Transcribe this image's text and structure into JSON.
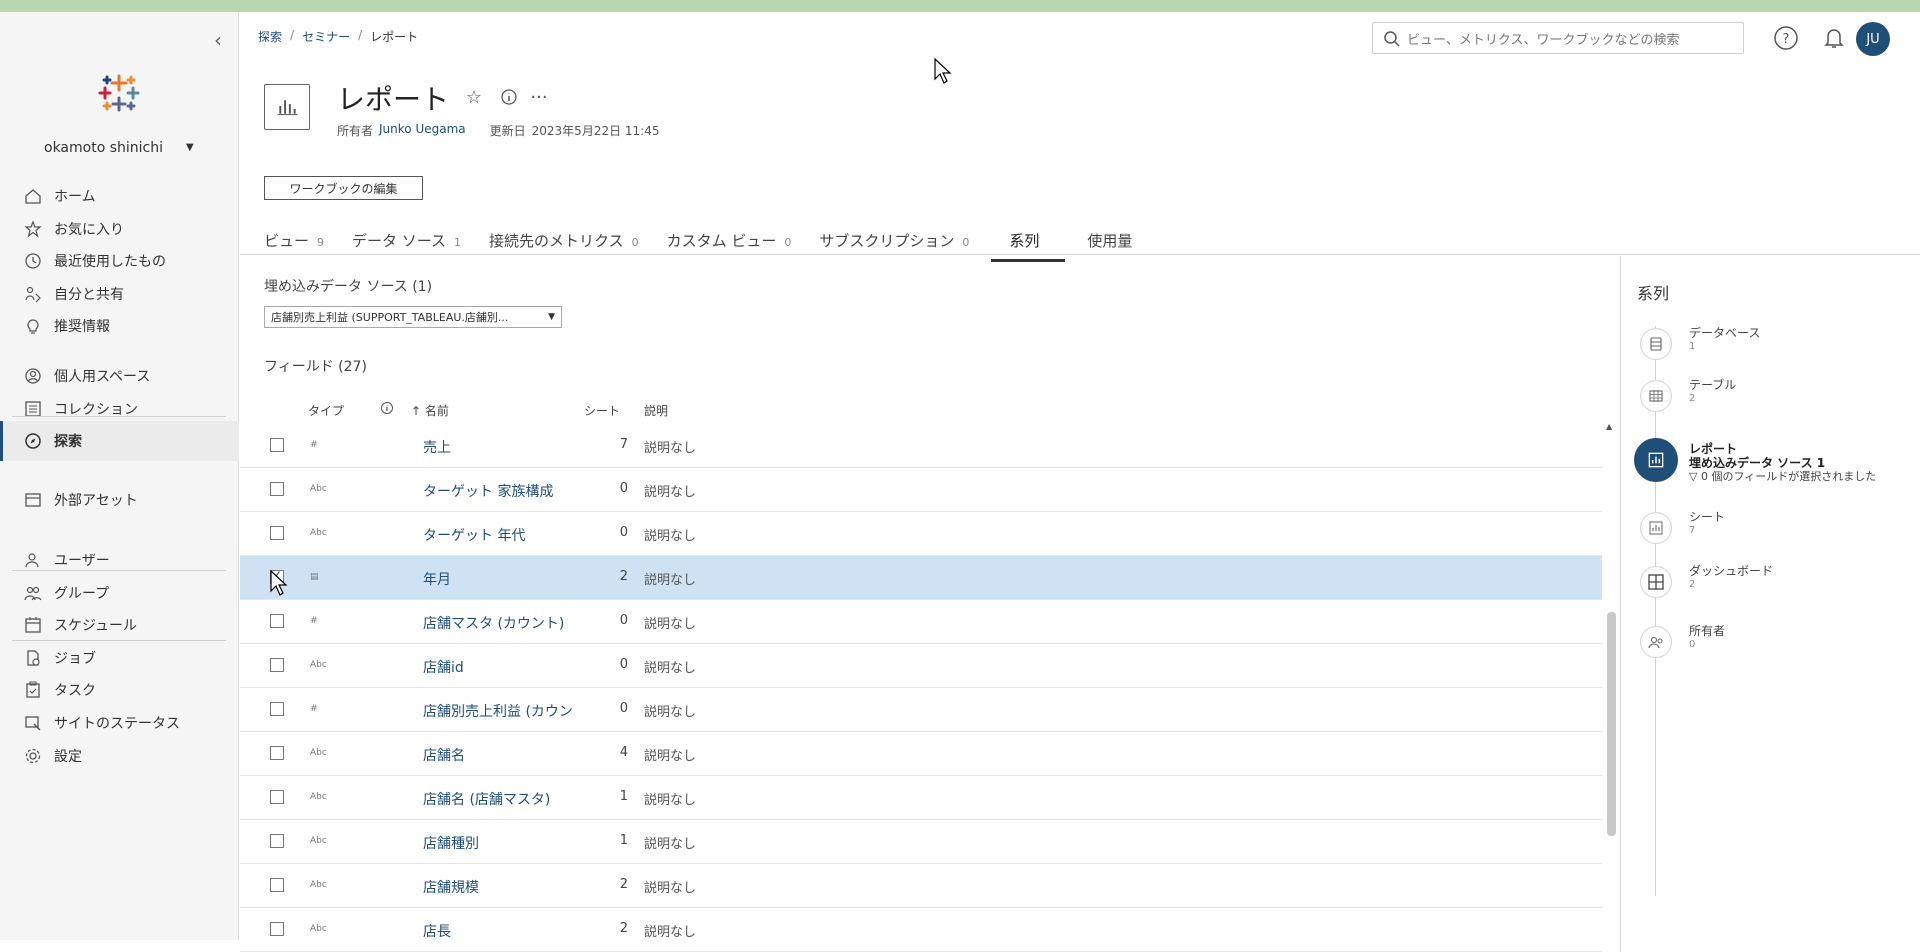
{
  "sidebar": {
    "user": "okamoto shinichi",
    "groups": [
      [
        {
          "label": "ホーム",
          "icon": "home-icon"
        },
        {
          "label": "お気に入り",
          "icon": "star-icon"
        },
        {
          "label": "最近使用したもの",
          "icon": "clock-icon"
        },
        {
          "label": "自分と共有",
          "icon": "share-icon"
        },
        {
          "label": "推奨情報",
          "icon": "lightbulb-icon"
        }
      ],
      [
        {
          "label": "個人用スペース",
          "icon": "person-icon"
        },
        {
          "label": "コレクション",
          "icon": "collection-icon"
        },
        {
          "label": "探索",
          "icon": "compass-icon",
          "active": true
        }
      ],
      [
        {
          "label": "外部アセット",
          "icon": "external-assets-icon"
        }
      ],
      [
        {
          "label": "ユーザー",
          "icon": "user-icon"
        },
        {
          "label": "グループ",
          "icon": "group-icon"
        },
        {
          "label": "スケジュール",
          "icon": "calendar-icon"
        },
        {
          "label": "ジョブ",
          "icon": "job-icon"
        },
        {
          "label": "タスク",
          "icon": "task-icon"
        },
        {
          "label": "サイトのステータス",
          "icon": "status-icon"
        },
        {
          "label": "設定",
          "icon": "gear-icon"
        }
      ]
    ]
  },
  "header": {
    "breadcrumb": [
      "探索",
      "セミナー",
      "レポート"
    ],
    "search_placeholder": "ビュー、メトリクス、ワークブックなどの検索",
    "avatar_initials": "JU"
  },
  "page": {
    "title": "レポート",
    "owner_label": "所有者",
    "owner": "Junko Uegama",
    "updated_label": "更新日",
    "updated": "2023年5月22日 11:45",
    "edit_button": "ワークブックの編集"
  },
  "tabs": [
    {
      "label": "ビュー",
      "count": "9"
    },
    {
      "label": "データ ソース",
      "count": "1"
    },
    {
      "label": "接続先のメトリクス",
      "count": "0"
    },
    {
      "label": "カスタム ビュー",
      "count": "0"
    },
    {
      "label": "サブスクリプション",
      "count": "0"
    },
    {
      "label": "系列",
      "count": "",
      "active": true
    },
    {
      "label": "使用量",
      "count": ""
    }
  ],
  "content": {
    "embedded_label": "埋め込みデータ ソース (1)",
    "datasource_select": "店舗別売上利益 (SUPPORT_TABLEAU.店舗別...",
    "fields_label": "フィールド (27)",
    "columns": {
      "type": "タイプ",
      "name": "↑ 名前",
      "sheets": "シート",
      "desc": "説明"
    },
    "rows": [
      {
        "type": "#",
        "name": "売上",
        "sheets": "7",
        "desc": "説明なし",
        "checked": false
      },
      {
        "type": "Abc",
        "name": "ターゲット 家族構成",
        "sheets": "0",
        "desc": "説明なし",
        "checked": false
      },
      {
        "type": "Abc",
        "name": "ターゲット 年代",
        "sheets": "0",
        "desc": "説明なし",
        "checked": false
      },
      {
        "type": "▤",
        "name": "年月",
        "sheets": "2",
        "desc": "説明なし",
        "checked": true
      },
      {
        "type": "#",
        "name": "店舗マスタ (カウント)",
        "sheets": "0",
        "desc": "説明なし",
        "checked": false
      },
      {
        "type": "Abc",
        "name": "店舗id",
        "sheets": "0",
        "desc": "説明なし",
        "checked": false
      },
      {
        "type": "#",
        "name": "店舗別売上利益 (カウン",
        "sheets": "0",
        "desc": "説明なし",
        "checked": false
      },
      {
        "type": "Abc",
        "name": "店舗名",
        "sheets": "4",
        "desc": "説明なし",
        "checked": false
      },
      {
        "type": "Abc",
        "name": "店舗名 (店舗マスタ)",
        "sheets": "1",
        "desc": "説明なし",
        "checked": false
      },
      {
        "type": "Abc",
        "name": "店舗種別",
        "sheets": "1",
        "desc": "説明なし",
        "checked": false
      },
      {
        "type": "Abc",
        "name": "店舗規模",
        "sheets": "2",
        "desc": "説明なし",
        "checked": false
      },
      {
        "type": "Abc",
        "name": "店長",
        "sheets": "2",
        "desc": "説明なし",
        "checked": false
      }
    ]
  },
  "lineage": {
    "title": "系列",
    "nodes": [
      {
        "label": "データベース",
        "count": "1",
        "icon": "database-icon"
      },
      {
        "label": "テーブル",
        "count": "2",
        "icon": "table-icon"
      },
      {
        "label": "レポート",
        "sub": "埋め込みデータ ソース 1",
        "sub2": "▽ 0 個のフィールドが選択されました",
        "icon": "report-icon",
        "active": true
      },
      {
        "label": "シート",
        "count": "7",
        "icon": "sheet-icon"
      },
      {
        "label": "ダッシュボード",
        "count": "2",
        "icon": "dashboard-icon"
      },
      {
        "label": "所有者",
        "count": "0",
        "icon": "owner-icon"
      }
    ]
  },
  "colors": {
    "accent": "#1f4e79",
    "selected_row": "#cfe2f3"
  }
}
